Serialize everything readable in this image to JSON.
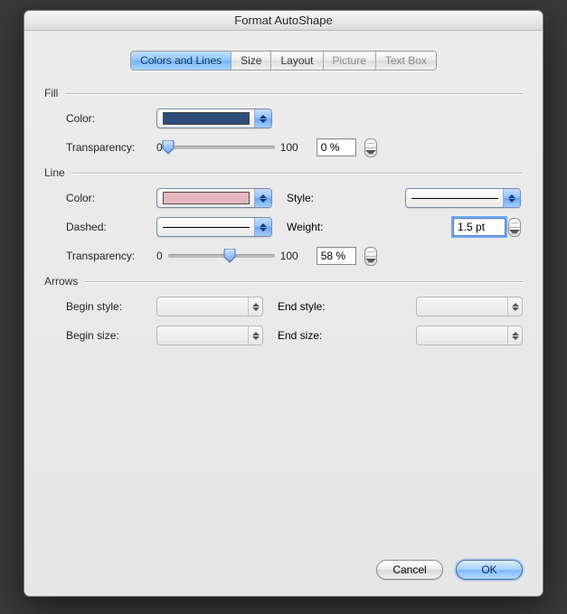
{
  "window": {
    "title": "Format AutoShape"
  },
  "tabs": {
    "items": [
      {
        "label": "Colors and Lines",
        "active": true,
        "disabled": false
      },
      {
        "label": "Size",
        "active": false,
        "disabled": false
      },
      {
        "label": "Layout",
        "active": false,
        "disabled": false
      },
      {
        "label": "Picture",
        "active": false,
        "disabled": true
      },
      {
        "label": "Text Box",
        "active": false,
        "disabled": true
      }
    ]
  },
  "fill": {
    "header": "Fill",
    "color_label": "Color:",
    "color_swatch": "#2e4d7a",
    "transparency_label": "Transparency:",
    "slider_min": "0",
    "slider_max": "100",
    "slider_percent": 0,
    "value_text": "0 %"
  },
  "line": {
    "header": "Line",
    "color_label": "Color:",
    "color_swatch": "#e7b7bf",
    "style_label": "Style:",
    "style_preview": "solid-1",
    "dashed_label": "Dashed:",
    "dashed_preview": "solid-1",
    "weight_label": "Weight:",
    "weight_value": "1.5 pt",
    "transparency_label": "Transparency:",
    "slider_min": "0",
    "slider_max": "100",
    "slider_percent": 58,
    "value_text": "58 %"
  },
  "arrows": {
    "header": "Arrows",
    "begin_style_label": "Begin style:",
    "end_style_label": "End style:",
    "begin_size_label": "Begin size:",
    "end_size_label": "End size:"
  },
  "footer": {
    "cancel": "Cancel",
    "ok": "OK"
  }
}
